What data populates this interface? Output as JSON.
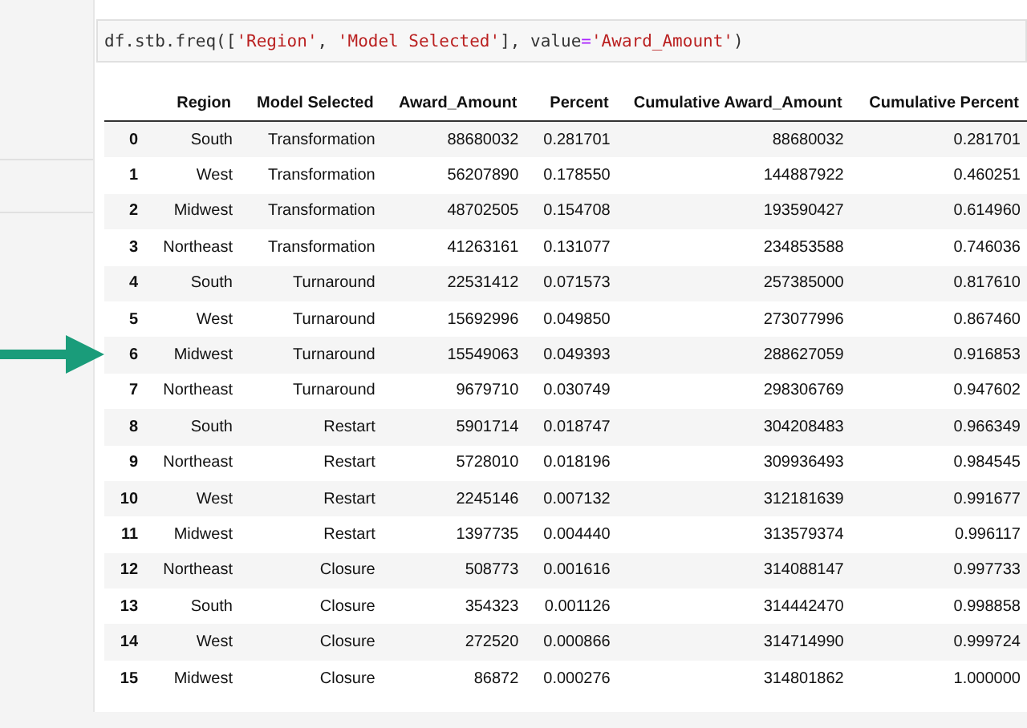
{
  "code_cell": {
    "code": [
      {
        "kind": "plain",
        "text": "df.stb.freq(["
      },
      {
        "kind": "string",
        "text": "'Region'"
      },
      {
        "kind": "plain",
        "text": ", "
      },
      {
        "kind": "string",
        "text": "'Model Selected'"
      },
      {
        "kind": "plain",
        "text": "], value"
      },
      {
        "kind": "operator",
        "text": "="
      },
      {
        "kind": "string",
        "text": "'Award_Amount'"
      },
      {
        "kind": "plain",
        "text": ")"
      }
    ]
  },
  "table": {
    "columns": [
      "",
      "Region",
      "Model Selected",
      "Award_Amount",
      "Percent",
      "Cumulative Award_Amount",
      "Cumulative Percent"
    ],
    "rows": [
      {
        "pointed": false,
        "cells": [
          "0",
          "South",
          "Transformation",
          "88680032",
          "0.281701",
          "88680032",
          "0.281701"
        ]
      },
      {
        "pointed": false,
        "cells": [
          "1",
          "West",
          "Transformation",
          "56207890",
          "0.178550",
          "144887922",
          "0.460251"
        ]
      },
      {
        "pointed": false,
        "cells": [
          "2",
          "Midwest",
          "Transformation",
          "48702505",
          "0.154708",
          "193590427",
          "0.614960"
        ]
      },
      {
        "pointed": false,
        "cells": [
          "3",
          "Northeast",
          "Transformation",
          "41263161",
          "0.131077",
          "234853588",
          "0.746036"
        ]
      },
      {
        "pointed": false,
        "cells": [
          "4",
          "South",
          "Turnaround",
          "22531412",
          "0.071573",
          "257385000",
          "0.817610"
        ]
      },
      {
        "pointed": false,
        "cells": [
          "5",
          "West",
          "Turnaround",
          "15692996",
          "0.049850",
          "273077996",
          "0.867460"
        ]
      },
      {
        "pointed": true,
        "cells": [
          "6",
          "Midwest",
          "Turnaround",
          "15549063",
          "0.049393",
          "288627059",
          "0.916853"
        ]
      },
      {
        "pointed": false,
        "cells": [
          "7",
          "Northeast",
          "Turnaround",
          "9679710",
          "0.030749",
          "298306769",
          "0.947602"
        ]
      },
      {
        "pointed": false,
        "cells": [
          "8",
          "South",
          "Restart",
          "5901714",
          "0.018747",
          "304208483",
          "0.966349"
        ]
      },
      {
        "pointed": false,
        "cells": [
          "9",
          "Northeast",
          "Restart",
          "5728010",
          "0.018196",
          "309936493",
          "0.984545"
        ]
      },
      {
        "pointed": false,
        "cells": [
          "10",
          "West",
          "Restart",
          "2245146",
          "0.007132",
          "312181639",
          "0.991677"
        ]
      },
      {
        "pointed": false,
        "cells": [
          "11",
          "Midwest",
          "Restart",
          "1397735",
          "0.004440",
          "313579374",
          "0.996117"
        ]
      },
      {
        "pointed": false,
        "cells": [
          "12",
          "Northeast",
          "Closure",
          "508773",
          "0.001616",
          "314088147",
          "0.997733"
        ]
      },
      {
        "pointed": false,
        "cells": [
          "13",
          "South",
          "Closure",
          "354323",
          "0.001126",
          "314442470",
          "0.998858"
        ]
      },
      {
        "pointed": false,
        "cells": [
          "14",
          "West",
          "Closure",
          "272520",
          "0.000866",
          "314714990",
          "0.999724"
        ]
      },
      {
        "pointed": false,
        "cells": [
          "15",
          "Midwest",
          "Closure",
          "86872",
          "0.000276",
          "314801862",
          "1.000000"
        ]
      }
    ]
  }
}
